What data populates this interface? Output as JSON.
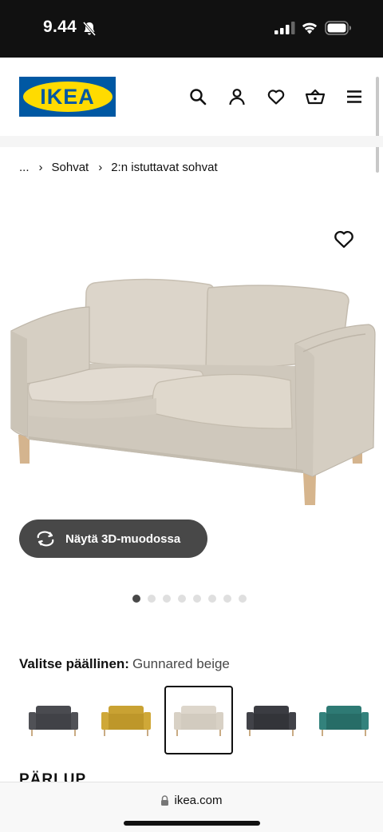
{
  "status_bar": {
    "time": "9.44"
  },
  "header": {
    "logo_text": "IKEA",
    "icons": [
      "search-icon",
      "user-icon",
      "heart-icon",
      "basket-icon",
      "menu-icon"
    ]
  },
  "breadcrumb": {
    "ellipsis": "...",
    "items": [
      "Sohvat",
      "2:n istuttavat sohvat"
    ]
  },
  "product": {
    "view_3d_label": "Näytä 3D-muodossa",
    "gallery_count": 8,
    "gallery_active_index": 0
  },
  "cover": {
    "label": "Valitse päällinen:",
    "value": "Gunnared beige",
    "swatches": [
      {
        "color": "#4a4b50",
        "selected": false
      },
      {
        "color": "#c9a233",
        "selected": false
      },
      {
        "color": "#ddd6cb",
        "selected": true
      },
      {
        "color": "#3b3c42",
        "selected": false
      },
      {
        "color": "#2e7a74",
        "selected": false
      }
    ]
  },
  "section_heading": "PÄRLUP",
  "url_bar": {
    "domain": "ikea.com"
  },
  "colors": {
    "brand_blue": "#0058a3",
    "brand_yellow": "#ffdb00",
    "button_dark": "#484848"
  }
}
